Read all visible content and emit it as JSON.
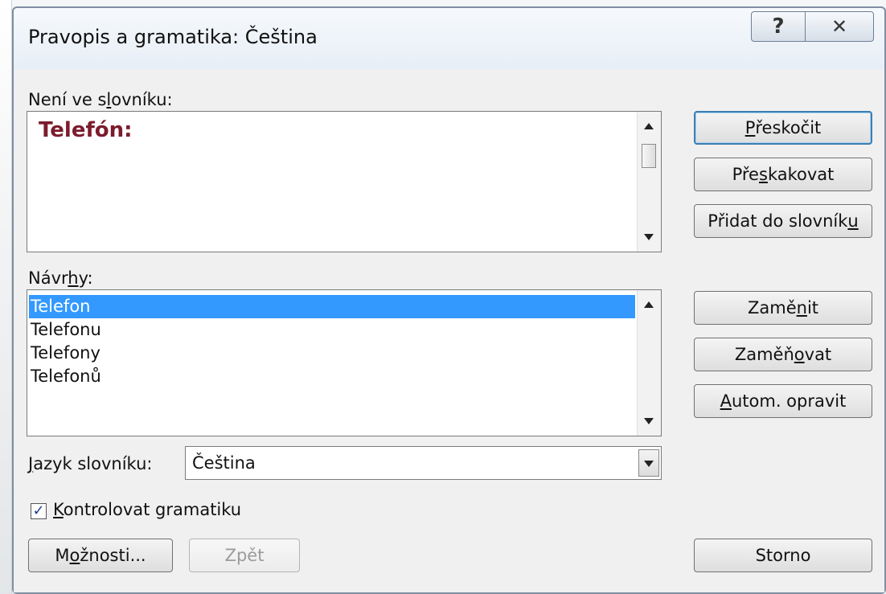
{
  "window": {
    "title": "Pravopis a gramatika: Čeština",
    "help_glyph": "?",
    "close_glyph": "✕"
  },
  "not_in_dictionary": {
    "label_pre": "Není ve s",
    "label_u": "l",
    "label_post": "ovníku:",
    "word": "Telefón:"
  },
  "suggestions": {
    "label_pre": "Návr",
    "label_u": "h",
    "label_post": "y:",
    "items": [
      "Telefon",
      "Telefonu",
      "Telefony",
      "Telefonů"
    ],
    "selected_index": 0
  },
  "language": {
    "label_u": "J",
    "label_post": "azyk slovníku:",
    "value": "Čeština"
  },
  "grammar_check": {
    "checked": true,
    "check_glyph": "✓",
    "label_u": "K",
    "label_post": "ontrolovat gramatiku"
  },
  "buttons": {
    "ignore_once": {
      "u": "P",
      "post": "řeskočit"
    },
    "ignore_all": {
      "pre": "Pře",
      "u": "s",
      "post": "kakovat"
    },
    "add_to_dictionary": {
      "pre": "Přidat do slovník",
      "u": "u"
    },
    "change": {
      "pre": "Zamě",
      "u": "n",
      "post": "it"
    },
    "change_all": {
      "pre": "Zaměň",
      "u": "o",
      "post": "vat"
    },
    "autocorrect": {
      "u": "A",
      "post": "utom. opravit"
    },
    "options": {
      "pre": "M",
      "u": "o",
      "post": "žnosti..."
    },
    "undo": "Zpět",
    "cancel": "Storno"
  }
}
